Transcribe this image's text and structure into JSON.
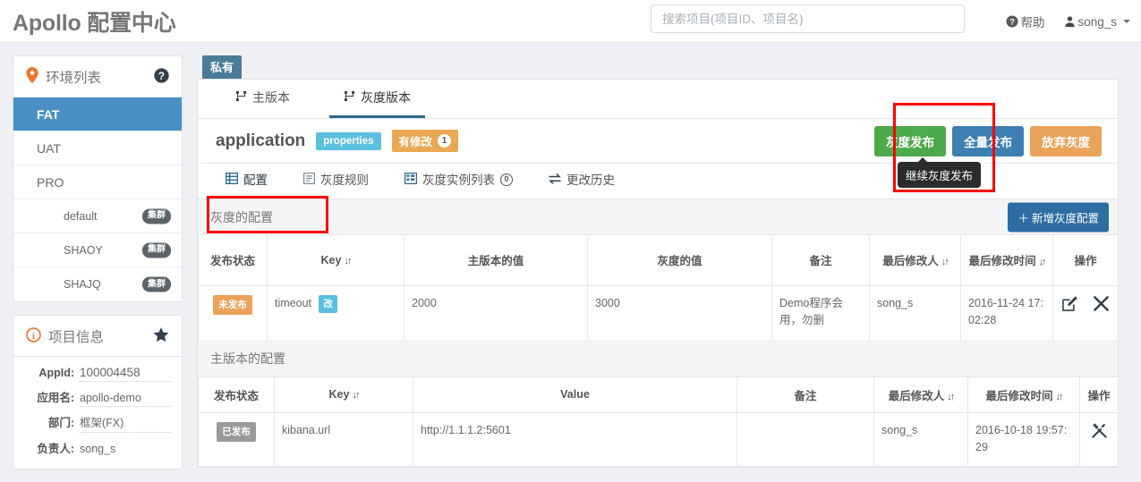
{
  "header": {
    "brand": "Apollo 配置中心",
    "search_placeholder": "搜索项目(项目ID、项目名)",
    "help_label": "帮助",
    "user_label": "song_s"
  },
  "sidebar": {
    "env_panel": {
      "title": "环境列表",
      "help_icon": "question-circle-icon",
      "items": [
        {
          "label": "FAT",
          "active": true,
          "cluster": false
        },
        {
          "label": "UAT",
          "active": false,
          "cluster": false
        },
        {
          "label": "PRO",
          "active": false,
          "cluster": false
        },
        {
          "label": "default",
          "active": false,
          "cluster": true,
          "tag": "集群"
        },
        {
          "label": "SHAOY",
          "active": false,
          "cluster": true,
          "tag": "集群"
        },
        {
          "label": "SHAJQ",
          "active": false,
          "cluster": true,
          "tag": "集群"
        }
      ]
    },
    "project_panel": {
      "title": "项目信息",
      "star_icon": "star-icon",
      "rows": [
        {
          "label": "AppId:",
          "value": "100004458"
        },
        {
          "label": "应用名:",
          "value": "apollo-demo"
        },
        {
          "label": "部门:",
          "value": "框架(FX)"
        },
        {
          "label": "负责人:",
          "value": "song_s"
        }
      ]
    }
  },
  "main": {
    "scope_tag": "私有",
    "version_tabs": [
      {
        "label": "主版本",
        "active": false
      },
      {
        "label": "灰度版本",
        "active": true
      }
    ],
    "app": {
      "name": "application",
      "format_badge": "properties",
      "modified_badge": "有修改",
      "modified_count": "1"
    },
    "actions": {
      "gray_release": "灰度发布",
      "full_release": "全量发布",
      "abandon_gray": "放弃灰度",
      "tooltip": "继续灰度发布"
    },
    "sub_tabs": [
      {
        "label": "配置",
        "active": true,
        "icon": "table-icon"
      },
      {
        "label": "灰度规则",
        "active": false,
        "icon": "list-icon"
      },
      {
        "label": "灰度实例列表",
        "active": false,
        "icon": "grid-icon",
        "count": "0"
      },
      {
        "label": "更改历史",
        "active": false,
        "icon": "exchange-icon"
      }
    ],
    "gray_section": {
      "title": "灰度的配置",
      "add_button": "新增灰度配置",
      "columns": [
        "发布状态",
        "Key",
        "主版本的值",
        "灰度的值",
        "备注",
        "最后修改人",
        "最后修改时间",
        "操作"
      ],
      "sortable": [
        false,
        true,
        false,
        false,
        false,
        true,
        true,
        false
      ],
      "rows": [
        {
          "status": "未发布",
          "status_type": "unpublished",
          "key": "timeout",
          "key_badge": "改",
          "master_value": "2000",
          "gray_value": "3000",
          "comment": "Demo程序会用，勿删",
          "modifier": "song_s",
          "modified_time": "2016-11-24 17:02:28",
          "ops": [
            "edit-icon",
            "delete-icon"
          ]
        }
      ]
    },
    "master_section": {
      "title": "主版本的配置",
      "columns": [
        "发布状态",
        "Key",
        "Value",
        "备注",
        "最后修改人",
        "最后修改时间",
        "操作"
      ],
      "sortable": [
        false,
        true,
        false,
        false,
        true,
        true,
        false
      ],
      "rows": [
        {
          "status": "已发布",
          "status_type": "published",
          "key": "kibana.url",
          "value": "http://1.1.1.2:5601",
          "comment": "",
          "modifier": "song_s",
          "modified_time": "2016-10-18 19:57:29",
          "ops": [
            "tools-icon"
          ]
        }
      ]
    }
  },
  "colors": {
    "accent_blue": "#4a90c4",
    "green": "#4ca94c",
    "orange": "#eaa35a",
    "cyan": "#5bc0de",
    "highlight_red": "#ff0000",
    "dark_blue": "#2b6a8c"
  }
}
